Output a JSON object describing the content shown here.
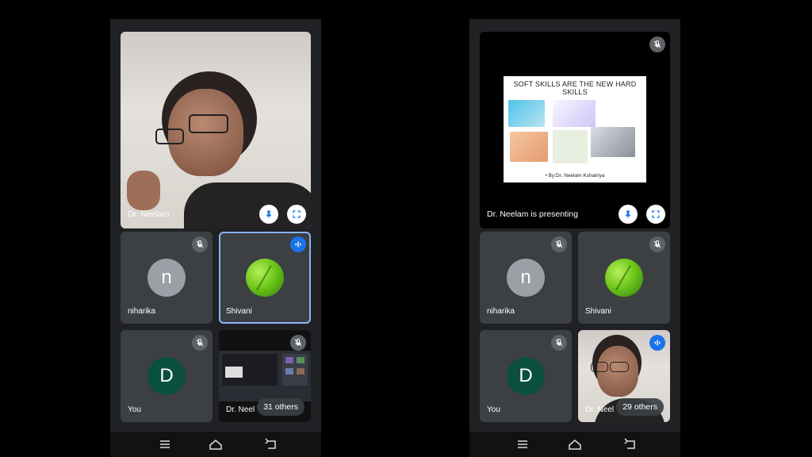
{
  "left": {
    "main": {
      "name": "Dr. Neelam"
    },
    "tiles": [
      {
        "name": "niharika",
        "initial": "n"
      },
      {
        "name": "Shivani"
      },
      {
        "name": "You",
        "initial": "D"
      },
      {
        "name": "Dr. Neel",
        "others": "31 others"
      }
    ]
  },
  "right": {
    "main": {
      "name": "Dr. Neelam is presenting",
      "slide_title": "SOFT SKILLS ARE THE NEW HARD SKILLS",
      "slide_footer": "• By:Dr. Neelam Kshatriya"
    },
    "tiles": [
      {
        "name": "niharika",
        "initial": "n"
      },
      {
        "name": "Shivani"
      },
      {
        "name": "You",
        "initial": "D"
      },
      {
        "name": "Dr. Neel",
        "others": "29 others"
      }
    ]
  },
  "icons": {
    "mute": "mic-off-icon",
    "speaking": "audio-level-icon",
    "pin": "pin-icon",
    "fullscreen": "fullscreen-icon",
    "nav": [
      "menu-icon",
      "home-icon",
      "back-icon"
    ]
  },
  "colors": {
    "tile": "#3c4043",
    "speaking": "#1a73e8",
    "selected_border": "#8ab4f8"
  }
}
